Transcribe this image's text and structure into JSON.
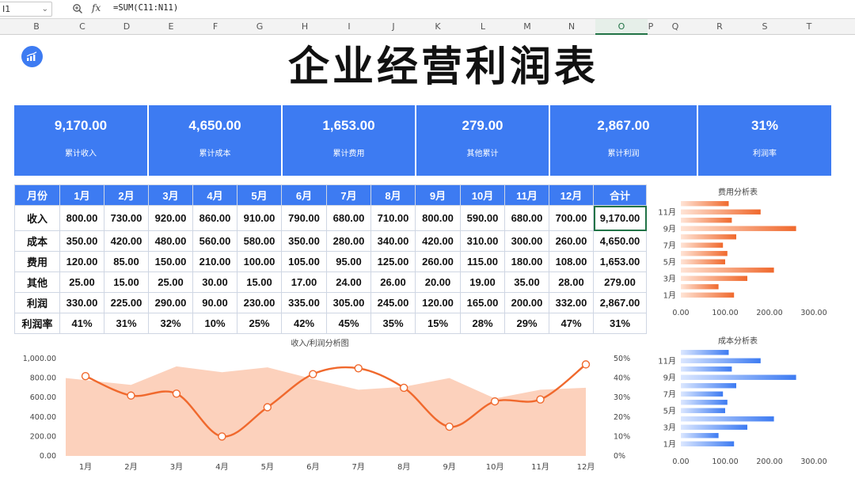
{
  "formula_bar": {
    "name_box": "I1",
    "formula": "=SUM(C11:N11)"
  },
  "columns": [
    "B",
    "C",
    "D",
    "E",
    "F",
    "G",
    "H",
    "I",
    "J",
    "K",
    "L",
    "M",
    "N",
    "O",
    "P",
    "Q",
    "R",
    "S",
    "T"
  ],
  "active_column": "O",
  "title": "企业经营利润表",
  "kpis": [
    {
      "value": "9,170.00",
      "label": "累计收入"
    },
    {
      "value": "4,650.00",
      "label": "累计成本"
    },
    {
      "value": "1,653.00",
      "label": "累计费用"
    },
    {
      "value": "279.00",
      "label": "其他累计"
    },
    {
      "value": "2,867.00",
      "label": "累计利润"
    },
    {
      "value": "31%",
      "label": "利润率"
    }
  ],
  "table": {
    "headers": [
      "月份",
      "1月",
      "2月",
      "3月",
      "4月",
      "5月",
      "6月",
      "7月",
      "8月",
      "9月",
      "10月",
      "11月",
      "12月",
      "合计"
    ],
    "rows": [
      [
        "收入",
        "800.00",
        "730.00",
        "920.00",
        "860.00",
        "910.00",
        "790.00",
        "680.00",
        "710.00",
        "800.00",
        "590.00",
        "680.00",
        "700.00",
        "9,170.00"
      ],
      [
        "成本",
        "350.00",
        "420.00",
        "480.00",
        "560.00",
        "580.00",
        "350.00",
        "280.00",
        "340.00",
        "420.00",
        "310.00",
        "300.00",
        "260.00",
        "4,650.00"
      ],
      [
        "费用",
        "120.00",
        "85.00",
        "150.00",
        "210.00",
        "100.00",
        "105.00",
        "95.00",
        "125.00",
        "260.00",
        "115.00",
        "180.00",
        "108.00",
        "1,653.00"
      ],
      [
        "其他",
        "25.00",
        "15.00",
        "25.00",
        "30.00",
        "15.00",
        "17.00",
        "24.00",
        "26.00",
        "20.00",
        "19.00",
        "35.00",
        "28.00",
        "279.00"
      ],
      [
        "利润",
        "330.00",
        "225.00",
        "290.00",
        "90.00",
        "230.00",
        "335.00",
        "305.00",
        "245.00",
        "120.00",
        "165.00",
        "200.00",
        "332.00",
        "2,867.00"
      ],
      [
        "利润率",
        "41%",
        "31%",
        "32%",
        "10%",
        "25%",
        "42%",
        "45%",
        "35%",
        "15%",
        "28%",
        "29%",
        "47%",
        "31%"
      ]
    ]
  },
  "chart_data": [
    {
      "type": "area",
      "title": "收入/利润分析图",
      "categories": [
        "1月",
        "2月",
        "3月",
        "4月",
        "5月",
        "6月",
        "7月",
        "8月",
        "9月",
        "10月",
        "11月",
        "12月"
      ],
      "series": [
        {
          "values": [
            800,
            730,
            920,
            860,
            910,
            790,
            680,
            710,
            800,
            590,
            680,
            700
          ],
          "axis": "left",
          "render": "area",
          "color": "#fcc9b0"
        },
        {
          "values": [
            0.41,
            0.31,
            0.32,
            0.1,
            0.25,
            0.42,
            0.45,
            0.35,
            0.15,
            0.28,
            0.29,
            0.47
          ],
          "axis": "right",
          "render": "smooth-line-markers",
          "color": "#f0692d"
        }
      ],
      "y_ticks_left": [
        "0.00",
        "200.00",
        "400.00",
        "600.00",
        "800.00",
        "1,000.00"
      ],
      "y_ticks_right": [
        "0%",
        "10%",
        "20%",
        "30%",
        "40%",
        "50%"
      ],
      "ylim_left": [
        0,
        1000
      ],
      "ylim_right": [
        0,
        0.5
      ],
      "grid": false
    },
    {
      "type": "bar",
      "orientation": "horizontal",
      "title": "费用分析表",
      "categories": [
        "1月",
        "2月",
        "3月",
        "4月",
        "5月",
        "6月",
        "7月",
        "8月",
        "9月",
        "10月",
        "11月",
        "12月"
      ],
      "category_labels_shown": [
        "1月",
        "3月",
        "5月",
        "7月",
        "9月",
        "11月"
      ],
      "values": [
        120,
        85,
        150,
        210,
        100,
        105,
        95,
        125,
        260,
        115,
        180,
        108
      ],
      "x_ticks": [
        "0.00",
        "100.00",
        "200.00",
        "300.00"
      ],
      "xlim": [
        0,
        300
      ],
      "gradient": [
        "#ffe4d6",
        "#f0692d"
      ]
    },
    {
      "type": "bar",
      "orientation": "horizontal",
      "title": "成本分析表",
      "categories": [
        "1月",
        "2月",
        "3月",
        "4月",
        "5月",
        "6月",
        "7月",
        "8月",
        "9月",
        "10月",
        "11月",
        "12月"
      ],
      "category_labels_shown": [
        "1月",
        "3月",
        "5月",
        "7月",
        "9月",
        "11月"
      ],
      "values": [
        120,
        85,
        150,
        210,
        100,
        105,
        95,
        125,
        260,
        115,
        180,
        108
      ],
      "x_ticks": [
        "0.00",
        "100.00",
        "200.00",
        "300.00"
      ],
      "xlim": [
        0,
        300
      ],
      "gradient": [
        "#dbe7ff",
        "#3d7bf2"
      ]
    }
  ]
}
